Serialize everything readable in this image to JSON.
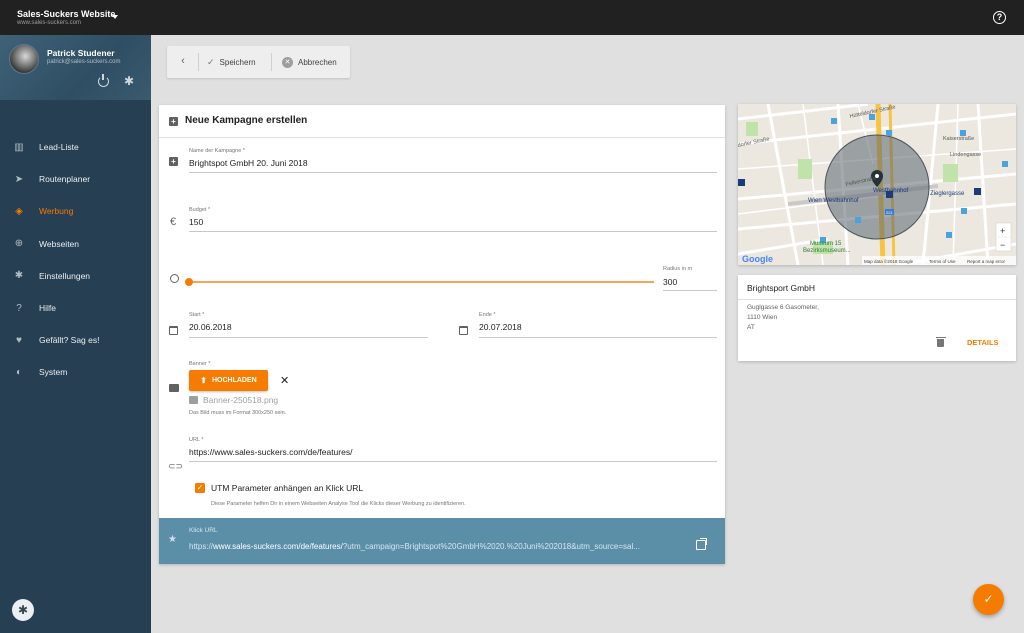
{
  "topbar": {
    "site_title": "Sales-Suckers Website",
    "site_url": "www.sales-suckers.com",
    "help_icon": "?"
  },
  "user": {
    "name": "Patrick Studener",
    "email": "patrick@sales-suckers.com"
  },
  "nav": {
    "items": [
      {
        "label": "Lead-Liste",
        "icon": "building-icon",
        "glyph": "▥"
      },
      {
        "label": "Routenplaner",
        "icon": "navigation-icon",
        "glyph": "➤"
      },
      {
        "label": "Werbung",
        "icon": "ad-icon",
        "glyph": "◈",
        "active": true
      },
      {
        "label": "Webseiten",
        "icon": "globe-icon",
        "glyph": "⊕"
      },
      {
        "label": "Einstellungen",
        "icon": "gear-icon",
        "glyph": "✱"
      },
      {
        "label": "Hilfe",
        "icon": "help-icon",
        "glyph": "?"
      },
      {
        "label": "Gefällt? Sag es!",
        "icon": "heart-icon",
        "glyph": "♥"
      },
      {
        "label": "System",
        "icon": "shield-icon",
        "glyph": "◐"
      }
    ]
  },
  "toolbar": {
    "save_label": "Speichern",
    "cancel_label": "Abbrechen"
  },
  "form": {
    "title": "Neue Kampagne erstellen",
    "name_label": "Name der Kampagne *",
    "name_value": "Brightspot GmbH 20. Juni 2018",
    "budget_label": "Budget *",
    "budget_value": "150",
    "budget_icon": "€",
    "radius_label": "Radius in m",
    "radius_value": "300",
    "radius_slider_fraction": 0,
    "start_label": "Start *",
    "start_value": "20.06.2018",
    "end_label": "Ende *",
    "end_value": "20.07.2018",
    "banner_label": "Banner *",
    "upload_label": "HOCHLADEN",
    "banner_file": "Banner-250518.png",
    "banner_hint": "Das Bild muss im Format 300x250 sein.",
    "url_label": "URL *",
    "url_value": "https://www.sales-suckers.com/de/features/",
    "utm_label": "UTM Parameter anhängen an Klick URL",
    "utm_checked": true,
    "utm_hint": "Diese Parameter helfen Dir in einem Webseiten Analyse Tool die Klicks dieser Werbung zu identifizieren.",
    "click_label": "Klick URL",
    "click_url_prefix": "https://",
    "click_url_main": "www.sales-suckers.com/de/features/",
    "click_url_query": "?utm_campaign=Brightspot%20GmbH%2020.%20Juni%202018&utm_source=sal..."
  },
  "map": {
    "labels": {
      "huetteldorfer": "Hütteldorfer Straße",
      "hueteldorfer2": "dorfer Straße",
      "felberstrasse": "Felberstraße",
      "westbahnhof": "Westbahnhof",
      "wien_west": "Wien Westbahnhof",
      "zieglergasse": "Zieglergasse",
      "museum": "Museum 15",
      "bezirksmuseum": "Bezirksmuseum...",
      "kaiserstr": "Kaiserstraße",
      "lindengasse": "Lindengasse",
      "road_num": "221"
    },
    "logo": "Google",
    "map_data": "Map data ©2018 Google",
    "terms": "Terms of Use",
    "report": "Report a map error",
    "zoom_in": "+",
    "zoom_out": "−"
  },
  "location": {
    "title": "Brightsport GmbH",
    "address_line1": "Guglgasse 6 Gasometer,",
    "address_line2": "1110 Wien",
    "address_line3": "AT",
    "details_label": "DETAILS"
  },
  "fab": {
    "icon": "check-icon",
    "glyph": "✓"
  },
  "colors": {
    "accent": "#f57c00",
    "sidebar": "#263f52",
    "topbar": "#212121",
    "click_bar": "#5b8fa8"
  }
}
